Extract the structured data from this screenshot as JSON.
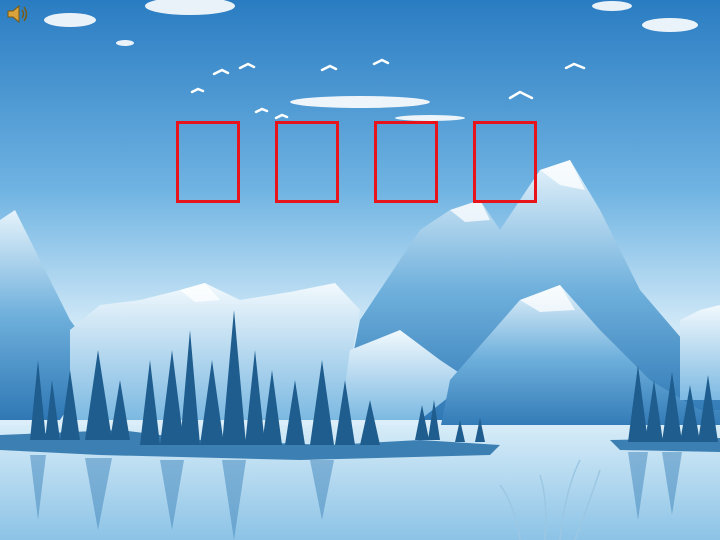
{
  "slide": {
    "title_chars": [
      "",
      "",
      "",
      ""
    ],
    "colors": {
      "title": "#e8141b",
      "sky_top": "#2f80c4",
      "mountain": "#8fc6e8"
    }
  },
  "icons": {
    "audio": "speaker-icon"
  }
}
